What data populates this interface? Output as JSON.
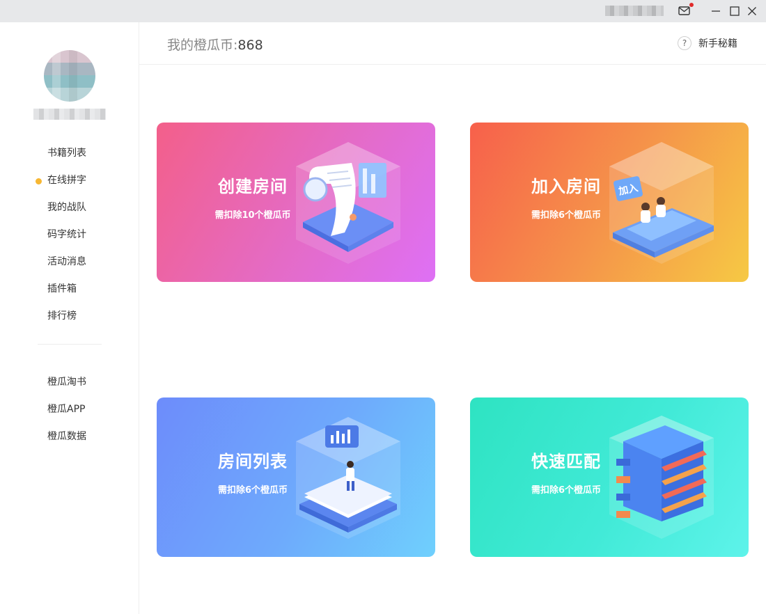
{
  "window": {
    "icons": [
      "mail-icon",
      "minimize-icon",
      "maximize-icon",
      "close-icon"
    ],
    "notification_color": "#e02a2a"
  },
  "header": {
    "coins_label": "我的橙瓜币:",
    "coins_value": "868",
    "help_icon_glyph": "?",
    "help_label": "新手秘籍"
  },
  "sidebar": {
    "active_color": "#f7b733",
    "items": [
      {
        "label": "书籍列表",
        "active": false
      },
      {
        "label": "在线拼字",
        "active": true
      },
      {
        "label": "我的战队",
        "active": false
      },
      {
        "label": "码字统计",
        "active": false
      },
      {
        "label": "活动消息",
        "active": false
      },
      {
        "label": "插件箱",
        "active": false
      },
      {
        "label": "排行榜",
        "active": false
      }
    ],
    "links": [
      {
        "label": "橙瓜淘书"
      },
      {
        "label": "橙瓜APP"
      },
      {
        "label": "橙瓜数据"
      }
    ]
  },
  "cards": [
    {
      "title": "创建房间",
      "subtitle": "需扣除10个橙瓜币",
      "icon": "document-scroll-icon",
      "colors": [
        "#f35f8a",
        "#de70f5"
      ]
    },
    {
      "title": "加入房间",
      "subtitle": "需扣除6个橙瓜币",
      "icon": "join-room-icon",
      "badge_text": "加入",
      "colors": [
        "#f7604b",
        "#f6c944"
      ]
    },
    {
      "title": "房间列表",
      "subtitle": "需扣除6个橙瓜币",
      "icon": "room-list-icon",
      "colors": [
        "#6d8cfb",
        "#6fd0fd"
      ]
    },
    {
      "title": "快速匹配",
      "subtitle": "需扣除6个橙瓜币",
      "icon": "server-stack-icon",
      "colors": [
        "#2ee3c2",
        "#5ef3ea"
      ]
    }
  ]
}
